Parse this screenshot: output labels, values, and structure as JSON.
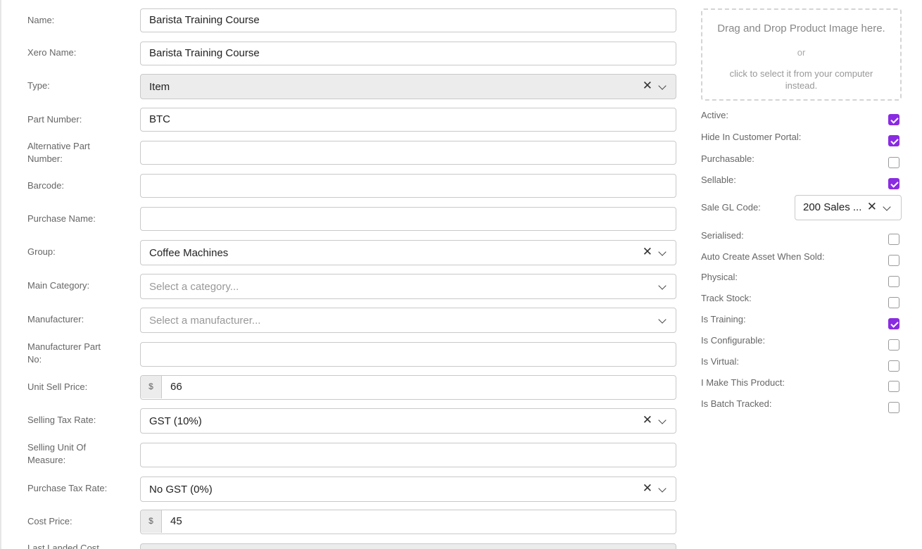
{
  "form": {
    "name": {
      "label": "Name:",
      "value": "Barista Training Course"
    },
    "xero_name": {
      "label": "Xero Name:",
      "value": "Barista Training Course"
    },
    "type": {
      "label": "Type:",
      "value": "Item",
      "clear": "✕"
    },
    "part_number": {
      "label": "Part Number:",
      "value": "BTC"
    },
    "alt_part_number": {
      "label": "Alternative Part Number:",
      "value": ""
    },
    "barcode": {
      "label": "Barcode:",
      "value": ""
    },
    "purchase_name": {
      "label": "Purchase Name:",
      "value": ""
    },
    "group": {
      "label": "Group:",
      "value": "Coffee Machines",
      "clear": "✕"
    },
    "main_category": {
      "label": "Main Category:",
      "placeholder": "Select a category..."
    },
    "manufacturer": {
      "label": "Manufacturer:",
      "placeholder": "Select a manufacturer..."
    },
    "manufacturer_part_no": {
      "label": "Manufacturer Part No:",
      "value": ""
    },
    "unit_sell_price": {
      "label": "Unit Sell Price:",
      "currency": "$",
      "value": "66"
    },
    "selling_tax_rate": {
      "label": "Selling Tax Rate:",
      "value": "GST (10%)",
      "clear": "✕"
    },
    "selling_uom": {
      "label": "Selling Unit Of Measure:",
      "value": ""
    },
    "purchase_tax_rate": {
      "label": "Purchase Tax Rate:",
      "value": "No GST (0%)",
      "clear": "✕"
    },
    "cost_price": {
      "label": "Cost Price:",
      "currency": "$",
      "value": "45"
    },
    "last_landed_cost": {
      "label": "Last Landed Cost"
    }
  },
  "image_dropzone": {
    "title": "Drag and Drop Product Image here.",
    "or": "or",
    "subtitle": "click to select it from your computer instead."
  },
  "flags": {
    "active": {
      "label": "Active:",
      "checked": true
    },
    "hide_portal": {
      "label": "Hide In Customer Portal:",
      "checked": true
    },
    "purchasable": {
      "label": "Purchasable:",
      "checked": false
    },
    "sellable": {
      "label": "Sellable:",
      "checked": true
    },
    "sale_gl_code": {
      "label": "Sale GL Code:",
      "value": "200 Sales ...",
      "clear": "✕"
    },
    "serialised": {
      "label": "Serialised:",
      "checked": false
    },
    "auto_asset": {
      "label": "Auto Create Asset When Sold:",
      "checked": false
    },
    "physical": {
      "label": "Physical:",
      "checked": false
    },
    "track_stock": {
      "label": "Track Stock:",
      "checked": false
    },
    "is_training": {
      "label": "Is Training:",
      "checked": true
    },
    "is_configurable": {
      "label": "Is Configurable:",
      "checked": false
    },
    "is_virtual": {
      "label": "Is Virtual:",
      "checked": false
    },
    "i_make": {
      "label": "I Make This Product:",
      "checked": false
    },
    "batch_tracked": {
      "label": "Is Batch Tracked:",
      "checked": false
    }
  },
  "colors": {
    "accent": "#8a2be2",
    "border": "#c9c9c9",
    "label": "#666666"
  }
}
